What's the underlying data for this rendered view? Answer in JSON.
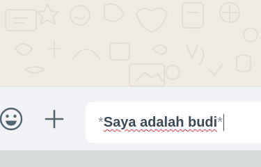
{
  "composer": {
    "emoji_icon": "smiley-icon",
    "attach_icon": "plus-icon",
    "message_prefix": "*",
    "message_text": "Saya adalah budi",
    "message_suffix": "*"
  },
  "colors": {
    "chat_background": "#efeae2",
    "composer_background": "#f0f2f5",
    "icon": "#54656f",
    "text": "#3b4a54",
    "spellcheck_underline": "#e0383e"
  }
}
